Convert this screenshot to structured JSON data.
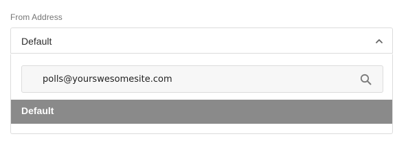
{
  "field": {
    "label": "From Address"
  },
  "select": {
    "value": "Default",
    "expanded": true
  },
  "search": {
    "value": "polls@yourswesomesite.com",
    "placeholder": ""
  },
  "options": [
    {
      "label": "Default",
      "selected": true
    }
  ],
  "icons": {
    "chevron": "chevron-up-icon",
    "search": "search-icon"
  },
  "colors": {
    "selected_option_bg": "#8a8a8a",
    "selected_option_text": "#ffffff",
    "border": "#dcdcdc"
  }
}
